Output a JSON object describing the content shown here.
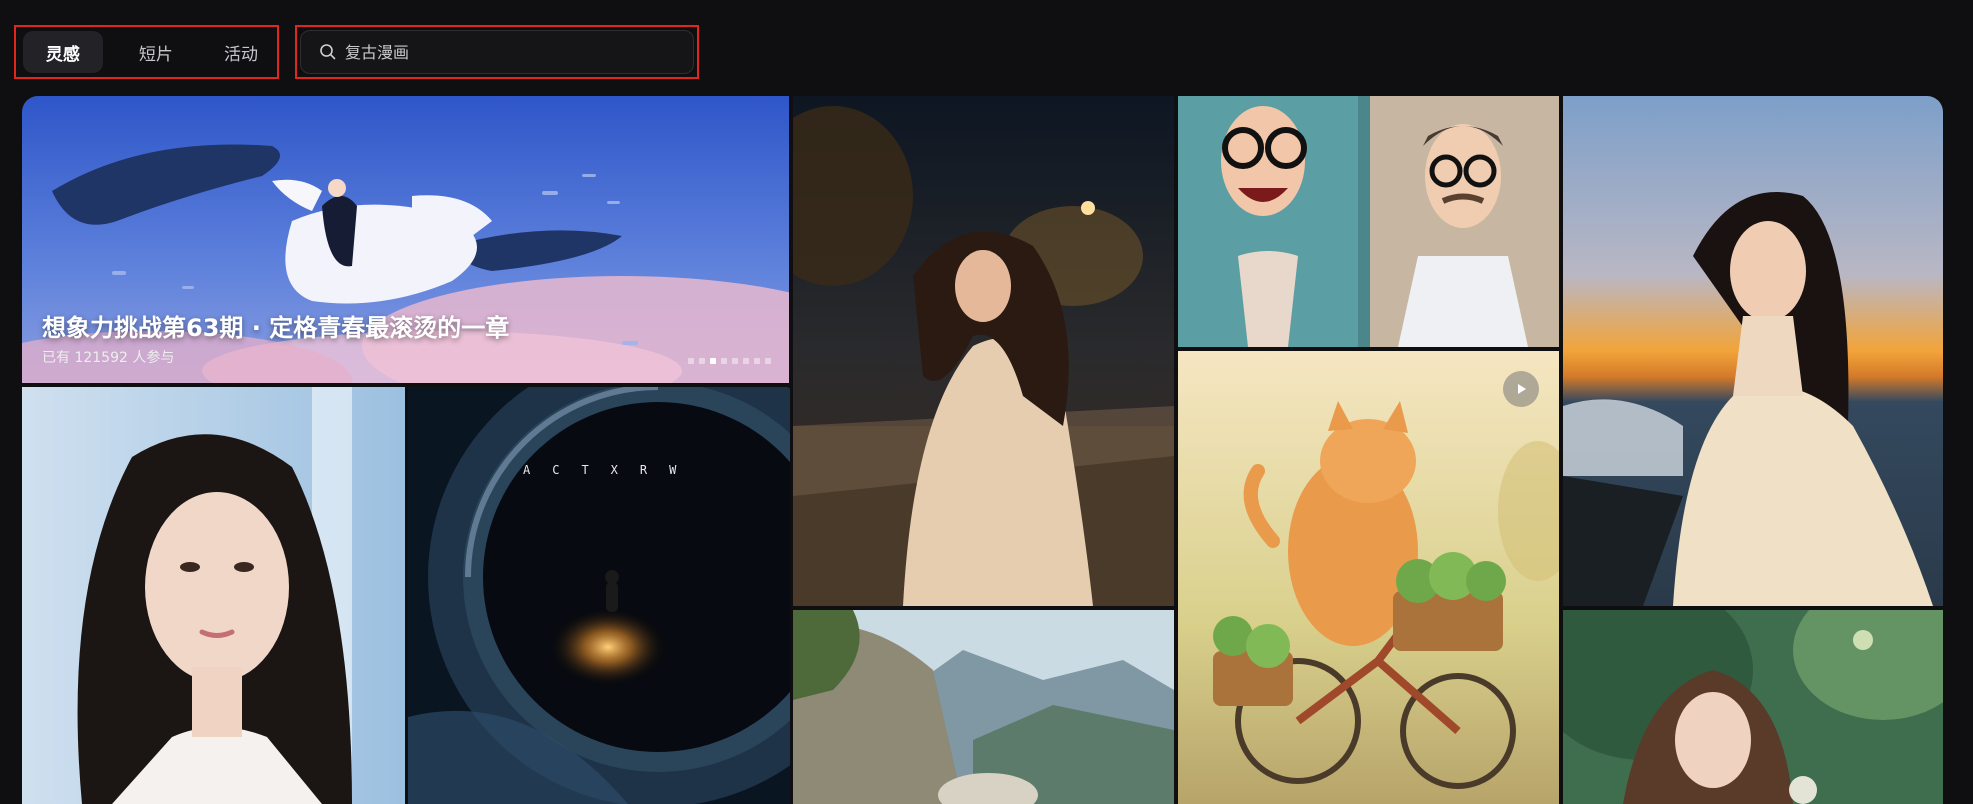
{
  "header": {
    "tabs": [
      {
        "label": "灵感",
        "active": true
      },
      {
        "label": "短片",
        "active": false
      },
      {
        "label": "活动",
        "active": false
      }
    ],
    "search": {
      "icon": "search-icon",
      "placeholder": "复古漫画"
    }
  },
  "banner": {
    "title": "想象力挑战第63期 · 定格青春最滚烫的一章",
    "subtitle": "已有 121592 人参与",
    "slides_total": 8,
    "slide_active": 3
  },
  "tiles": {
    "space": {
      "caption": "ACTXRW"
    },
    "cat": {
      "play_icon": "play-icon"
    }
  },
  "colors": {
    "accent_outline": "#e0271d",
    "background": "#0f0f11"
  }
}
